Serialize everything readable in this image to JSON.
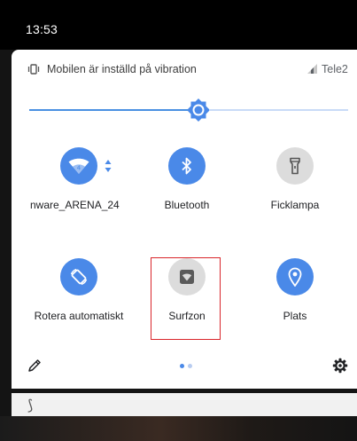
{
  "status_bar": {
    "time": "13:53"
  },
  "header": {
    "ringer_mode": "Mobilen är inställd på vibration",
    "carrier": "Tele2"
  },
  "brightness": {
    "level": 0.53
  },
  "tiles": [
    {
      "id": "wifi",
      "label": "nware_ARENA_24",
      "icon": "wifi-icon",
      "wifi_badge": "4",
      "active": true
    },
    {
      "id": "bluetooth",
      "label": "Bluetooth",
      "icon": "bluetooth-icon",
      "active": true
    },
    {
      "id": "flashlight",
      "label": "Ficklampa",
      "icon": "flashlight-icon",
      "active": false
    },
    {
      "id": "rotate",
      "label": "Rotera automatiskt",
      "icon": "rotate-icon",
      "active": true
    },
    {
      "id": "hotspot",
      "label": "Surfzon",
      "icon": "hotspot-icon",
      "active": false
    },
    {
      "id": "location",
      "label": "Plats",
      "icon": "location-icon",
      "active": true
    }
  ],
  "footer": {
    "page_count": 2,
    "current_page": 1
  },
  "notification": {
    "icon_glyph": "⟆"
  },
  "colors": {
    "accent": "#4a89e8",
    "tile_off": "#dcdcdc",
    "highlight": "#d9262b",
    "dot_active": "#4a89e8",
    "dot_inactive": "#b8ccf0"
  }
}
